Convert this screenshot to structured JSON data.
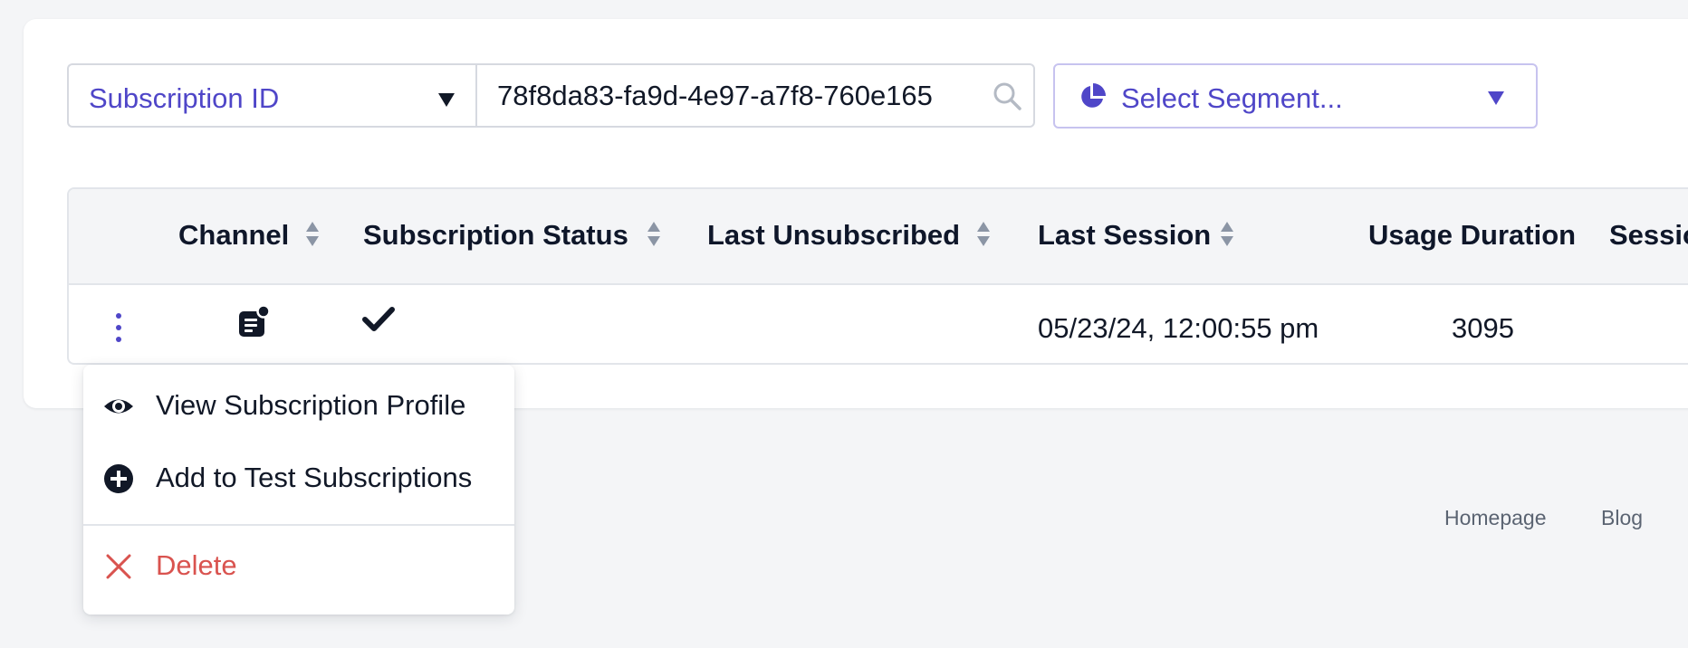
{
  "filter": {
    "field_label": "Subscription ID",
    "search_value": "78f8da83-fa9d-4e97-a7f8-760e165",
    "search_icon": "search-icon",
    "segment_label": "Select Segment...",
    "segment_icon": "pie-chart-icon"
  },
  "table": {
    "columns": {
      "channel": "Channel",
      "subscription_status": "Subscription Status",
      "last_unsubscribed": "Last Unsubscribed",
      "last_session": "Last Session",
      "usage_duration": "Usage Duration",
      "sessions": "Sessio"
    },
    "rows": [
      {
        "actions_icon": "kebab-menu-icon",
        "channel_icon": "sms-message-icon",
        "status_icon": "checkmark-icon",
        "last_unsubscribed": "",
        "last_session": "05/23/24, 12:00:55 pm",
        "usage_duration": "3095"
      }
    ]
  },
  "row_menu": {
    "items": [
      {
        "label": "View Subscription Profile",
        "icon": "eye-icon"
      },
      {
        "label": "Add to Test Subscriptions",
        "icon": "plus-circle-icon"
      },
      {
        "label": "Delete",
        "icon": "close-icon"
      }
    ]
  },
  "footer": {
    "links": [
      "Homepage",
      "Blog"
    ]
  },
  "colors": {
    "accent": "#4f46c8",
    "danger": "#d9534f",
    "text": "#0f172a",
    "page_background": "#f4f5f7"
  }
}
